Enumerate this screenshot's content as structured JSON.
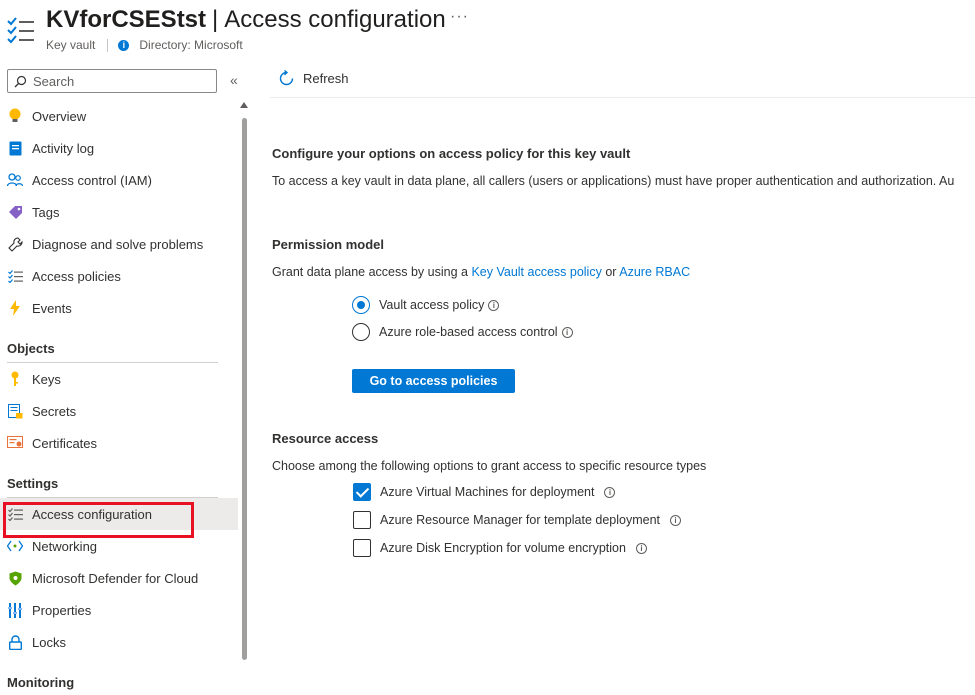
{
  "header": {
    "resource_name": "KVforCSEStst",
    "separator": "|",
    "page_name": "Access configuration",
    "more": "···",
    "resource_type": "Key vault",
    "directory": "Directory: Microsoft"
  },
  "sidebar": {
    "search_placeholder": "Search",
    "collapse": "«",
    "items": [
      {
        "label": "Overview",
        "icon": "lightbulb-icon"
      },
      {
        "label": "Activity log",
        "icon": "activity-log-icon"
      },
      {
        "label": "Access control (IAM)",
        "icon": "people-icon"
      },
      {
        "label": "Tags",
        "icon": "tag-icon"
      },
      {
        "label": "Diagnose and solve problems",
        "icon": "wrench-icon"
      },
      {
        "label": "Access policies",
        "icon": "list-icon"
      },
      {
        "label": "Events",
        "icon": "lightning-icon"
      }
    ],
    "section_objects": "Objects",
    "objects": [
      {
        "label": "Keys",
        "icon": "key-icon"
      },
      {
        "label": "Secrets",
        "icon": "secret-icon"
      },
      {
        "label": "Certificates",
        "icon": "certificate-icon"
      }
    ],
    "section_settings": "Settings",
    "settings": [
      {
        "label": "Access configuration",
        "icon": "list-icon"
      },
      {
        "label": "Networking",
        "icon": "networking-icon"
      },
      {
        "label": "Microsoft Defender for Cloud",
        "icon": "shield-icon"
      },
      {
        "label": "Properties",
        "icon": "properties-icon"
      },
      {
        "label": "Locks",
        "icon": "lock-icon"
      }
    ],
    "section_monitoring": "Monitoring"
  },
  "toolbar": {
    "refresh_label": "Refresh"
  },
  "main": {
    "config_heading": "Configure your options on access policy for this key vault",
    "config_desc": "To access a key vault in data plane, all callers (users or applications) must have proper authentication and authorization. Au",
    "permission_heading": "Permission model",
    "permission_desc_prefix": "Grant data plane access by using a",
    "permission_link1": "Key Vault access policy",
    "permission_or": "or",
    "permission_link2": "Azure RBAC",
    "radio_vault": "Vault access policy",
    "radio_rbac": "Azure role-based access control",
    "go_button": "Go to access policies",
    "resource_heading": "Resource access",
    "resource_desc": "Choose among the following options to grant access to specific resource types",
    "check_vm": "Azure Virtual Machines for deployment",
    "check_arm": "Azure Resource Manager for template deployment",
    "check_disk": "Azure Disk Encryption for volume encryption"
  },
  "colors": {
    "accent": "#0078d4",
    "highlight": "#e81123"
  }
}
